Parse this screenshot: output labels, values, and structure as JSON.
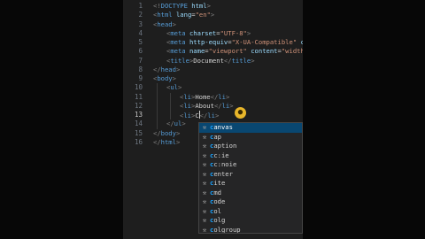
{
  "editor": {
    "line_numbers": [
      "1",
      "2",
      "3",
      "4",
      "5",
      "6",
      "7",
      "8",
      "9",
      "10",
      "11",
      "12",
      "13",
      "14",
      "15",
      "16"
    ],
    "active_line": "13",
    "lines": [
      {
        "indent": 0,
        "tokens": [
          [
            "bracket",
            "<!"
          ],
          [
            "tag",
            "DOCTYPE"
          ],
          [
            "attr",
            " html"
          ],
          [
            "bracket",
            ">"
          ]
        ]
      },
      {
        "indent": 0,
        "tokens": [
          [
            "bracket",
            "<"
          ],
          [
            "tag",
            "html"
          ],
          [
            "attr",
            " lang"
          ],
          [
            "txt",
            "="
          ],
          [
            "str",
            "\"en\""
          ],
          [
            "bracket",
            ">"
          ]
        ]
      },
      {
        "indent": 0,
        "tokens": [
          [
            "bracket",
            "<"
          ],
          [
            "tag",
            "head"
          ],
          [
            "bracket",
            ">"
          ]
        ]
      },
      {
        "indent": 1,
        "tokens": [
          [
            "bracket",
            "<"
          ],
          [
            "tag",
            "meta"
          ],
          [
            "attr",
            " charset"
          ],
          [
            "txt",
            "="
          ],
          [
            "str",
            "\"UTF-8\""
          ],
          [
            "bracket",
            ">"
          ]
        ]
      },
      {
        "indent": 1,
        "tokens": [
          [
            "bracket",
            "<"
          ],
          [
            "tag",
            "meta"
          ],
          [
            "attr",
            " http-equiv"
          ],
          [
            "txt",
            "="
          ],
          [
            "str",
            "\"X-UA-Compatible\""
          ],
          [
            "attr",
            " conte"
          ]
        ]
      },
      {
        "indent": 1,
        "tokens": [
          [
            "bracket",
            "<"
          ],
          [
            "tag",
            "meta"
          ],
          [
            "attr",
            " name"
          ],
          [
            "txt",
            "="
          ],
          [
            "str",
            "\"viewport\""
          ],
          [
            "attr",
            " content"
          ],
          [
            "txt",
            "="
          ],
          [
            "str",
            "\"width=dev"
          ]
        ]
      },
      {
        "indent": 1,
        "tokens": [
          [
            "bracket",
            "<"
          ],
          [
            "tag",
            "title"
          ],
          [
            "bracket",
            ">"
          ],
          [
            "txt",
            "Document"
          ],
          [
            "bracket",
            "</"
          ],
          [
            "tag",
            "title"
          ],
          [
            "bracket",
            ">"
          ]
        ]
      },
      {
        "indent": 0,
        "tokens": [
          [
            "bracket",
            "</"
          ],
          [
            "tag",
            "head"
          ],
          [
            "bracket",
            ">"
          ]
        ]
      },
      {
        "indent": 0,
        "tokens": [
          [
            "bracket",
            "<"
          ],
          [
            "tag",
            "body"
          ],
          [
            "bracket",
            ">"
          ]
        ]
      },
      {
        "indent": 1,
        "tokens": [
          [
            "bracket",
            "<"
          ],
          [
            "tag",
            "ul"
          ],
          [
            "bracket",
            ">"
          ]
        ]
      },
      {
        "indent": 2,
        "tokens": [
          [
            "bracket",
            "<"
          ],
          [
            "tag",
            "li"
          ],
          [
            "bracket",
            ">"
          ],
          [
            "txt",
            "Home"
          ],
          [
            "bracket",
            "</"
          ],
          [
            "tag",
            "li"
          ],
          [
            "bracket",
            ">"
          ]
        ]
      },
      {
        "indent": 2,
        "tokens": [
          [
            "bracket",
            "<"
          ],
          [
            "tag",
            "li"
          ],
          [
            "bracket",
            ">"
          ],
          [
            "txt",
            "About"
          ],
          [
            "bracket",
            "</"
          ],
          [
            "tag",
            "li"
          ],
          [
            "bracket",
            ">"
          ]
        ]
      },
      {
        "indent": 2,
        "tokens": [
          [
            "bracket",
            "<"
          ],
          [
            "tag",
            "li"
          ],
          [
            "bracket",
            ">"
          ],
          [
            "txt",
            "C"
          ],
          [
            "cursor",
            ""
          ],
          [
            "bracket",
            "</"
          ],
          [
            "tag",
            "li"
          ],
          [
            "bracket",
            ">"
          ]
        ]
      },
      {
        "indent": 1,
        "tokens": [
          [
            "bracket",
            "</"
          ],
          [
            "tag",
            "ul"
          ],
          [
            "bracket",
            ">"
          ]
        ]
      },
      {
        "indent": 0,
        "tokens": [
          [
            "bracket",
            "</"
          ],
          [
            "tag",
            "body"
          ],
          [
            "bracket",
            ">"
          ]
        ]
      },
      {
        "indent": 0,
        "tokens": [
          [
            "bracket",
            "</"
          ],
          [
            "tag",
            "html"
          ],
          [
            "bracket",
            ">"
          ]
        ]
      }
    ]
  },
  "suggestions": {
    "selected_index": 0,
    "icon": "wrench-icon",
    "items": [
      {
        "first": "c",
        "rest": "anvas"
      },
      {
        "first": "c",
        "rest": "ap"
      },
      {
        "first": "c",
        "rest": "aption"
      },
      {
        "first": "c",
        "rest": "c:ie"
      },
      {
        "first": "c",
        "rest": "c:noie"
      },
      {
        "first": "c",
        "rest": "enter"
      },
      {
        "first": "c",
        "rest": "ite"
      },
      {
        "first": "c",
        "rest": "md"
      },
      {
        "first": "c",
        "rest": "ode"
      },
      {
        "first": "c",
        "rest": "ol"
      },
      {
        "first": "c",
        "rest": "olg"
      },
      {
        "first": "c",
        "rest": "olgroup"
      }
    ]
  },
  "lightbulb": {
    "icon": "lightbulb-icon",
    "color": "#e8b62a"
  },
  "colors": {
    "background": "#1e1e1e",
    "tag": "#569cd6",
    "attr": "#9cdcfe",
    "string": "#ce9178",
    "selection": "#094771",
    "match": "#18a3ff"
  }
}
